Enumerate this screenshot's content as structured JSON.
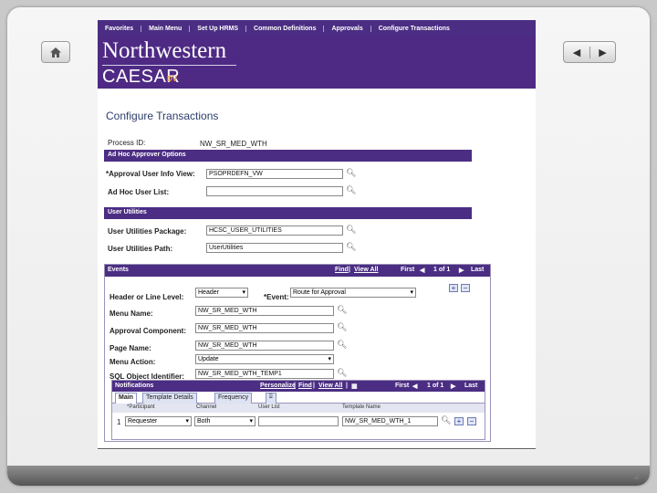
{
  "menu": [
    "Favorites",
    "Main Menu",
    "Set Up HRMS",
    "Common Definitions",
    "Approvals",
    "Configure Transactions"
  ],
  "brand": {
    "line1": "Northwestern",
    "line2": "CAESAR",
    "env": "DV"
  },
  "page_title": "Configure Transactions",
  "process": {
    "label": "Process ID:",
    "value": "NW_SR_MED_WTH"
  },
  "adhoc": {
    "header": "Ad Hoc Approver Options",
    "user_info_view_label": "*Approval User Info View:",
    "user_info_view_value": "PSOPRDEFN_VW",
    "user_list_label": "Ad Hoc User List:",
    "user_list_value": ""
  },
  "utilities": {
    "header": "User Utilities",
    "package_label": "User Utilities Package:",
    "package_value": "HCSC_USER_UTILITIES",
    "path_label": "User Utilities Path:",
    "path_value": "UserUtilities"
  },
  "events": {
    "header": "Events",
    "find": "Find",
    "view_all": "View All",
    "first": "First",
    "count": "1 of 1",
    "last": "Last",
    "level_label": "Header or Line Level:",
    "level_value": "Header",
    "event_label": "*Event:",
    "event_value": "Route for Approval",
    "menu_name_label": "Menu Name:",
    "menu_name_value": "NW_SR_MED_WTH",
    "component_label": "Approval Component:",
    "component_value": "NW_SR_MED_WTH",
    "page_label": "Page Name:",
    "page_value": "NW_SR_MED_WTH",
    "action_label": "Menu Action:",
    "action_value": "Update",
    "sql_label": "SQL Object Identifier:",
    "sql_value": "NW_SR_MED_WTH_TEMP1"
  },
  "notifications": {
    "header": "Notifications",
    "personalize": "Personalize",
    "find": "Find",
    "view_all": "View All",
    "first": "First",
    "count": "1 of 1",
    "last": "Last",
    "tabs": [
      "Main",
      "Template Details",
      "Frequency"
    ],
    "columns": [
      "*Participant",
      "Channel",
      "User List",
      "Template Name"
    ],
    "row": {
      "num": "1",
      "participant": "Requester",
      "channel": "Both",
      "user_list": "",
      "template": "NW_SR_MED_WTH_1"
    }
  }
}
